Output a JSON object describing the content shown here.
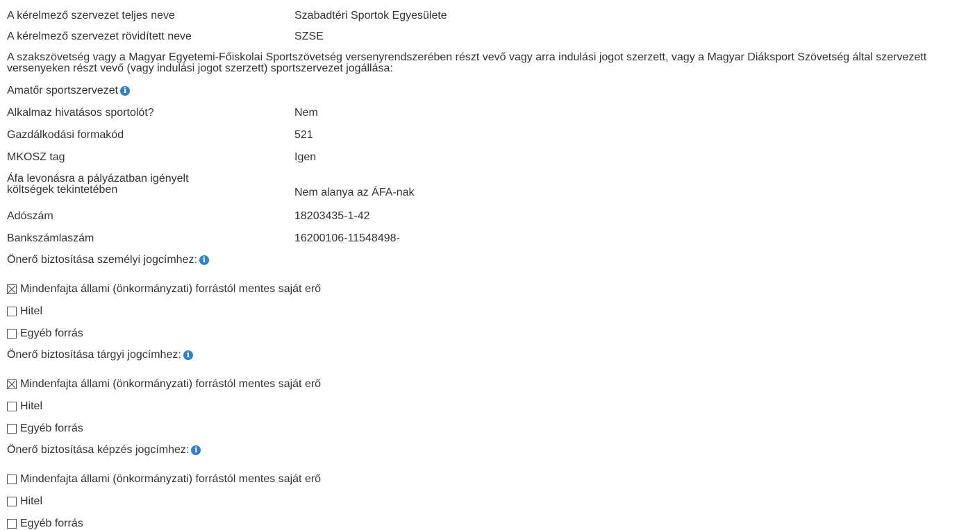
{
  "org": {
    "full_name_label": "A kérelmező szervezet teljes neve",
    "full_name_value": "Szabadtéri Sportok Egyesülete",
    "short_name_label": "A kérelmező szervezet rövidített neve",
    "short_name_value": "SZSE",
    "legal_status_question": "A szakszövetség vagy a Magyar Egyetemi-Főiskolai Sportszövetség versenyrendszerében részt vevő vagy arra indulási jogot szerzett, vagy a Magyar Diáksport Szövetség által szervezett versenyeken részt vevő (vagy indulási jogot szerzett) sportszervezet jogállása:",
    "legal_status_value": "Amatőr sportszervezet",
    "pro_athlete_label": "Alkalmaz hivatásos sportolót?",
    "pro_athlete_value": "Nem",
    "econ_form_label": "Gazdálkodási formakód",
    "econ_form_value": "521",
    "mkosz_label": "MKOSZ tag",
    "mkosz_value": "Igen",
    "vat_label": "Áfa levonásra a pályázatban igényelt költségek tekintetében",
    "vat_value": "Nem alanya az ÁFA-nak",
    "tax_id_label": "Adószám",
    "tax_id_value": "18203435-1-42",
    "bank_label": "Bankszámlaszám",
    "bank_value": "16200106-11548498-"
  },
  "icons": {
    "info_icon": "info-circle",
    "info_glyph": "i",
    "info_color": "#2f7fd3"
  },
  "own_funds": [
    {
      "title": "Önerő biztosítása személyi jogcímhez:",
      "options": [
        {
          "label": "Mindenfajta állami (önkormányzati) forrástól mentes saját erő",
          "checked": true
        },
        {
          "label": "Hitel",
          "checked": false
        },
        {
          "label": "Egyéb forrás",
          "checked": false
        }
      ]
    },
    {
      "title": "Önerő biztosítása tárgyi jogcímhez:",
      "options": [
        {
          "label": "Mindenfajta állami (önkormányzati) forrástól mentes saját erő",
          "checked": true
        },
        {
          "label": "Hitel",
          "checked": false
        },
        {
          "label": "Egyéb forrás",
          "checked": false
        }
      ]
    },
    {
      "title": "Önerő biztosítása képzés jogcímhez:",
      "options": [
        {
          "label": "Mindenfajta állami (önkormányzati) forrástól mentes saját erő",
          "checked": false
        },
        {
          "label": "Hitel",
          "checked": false
        },
        {
          "label": "Egyéb forrás",
          "checked": false
        }
      ]
    }
  ]
}
